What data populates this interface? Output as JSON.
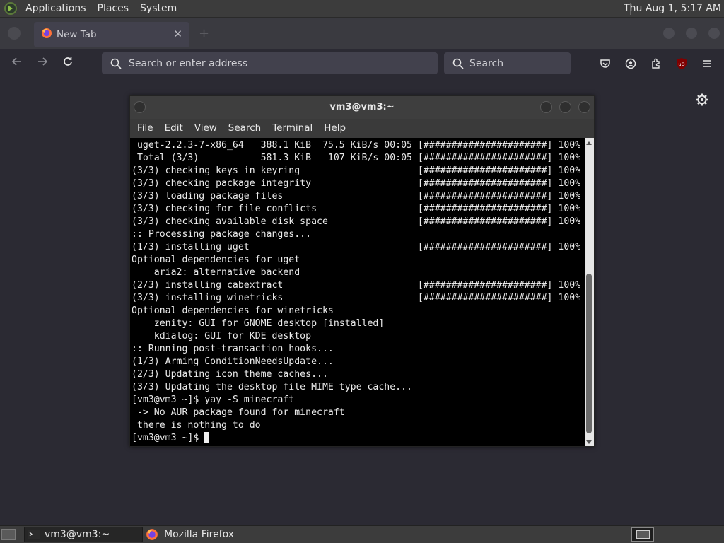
{
  "top_panel": {
    "menus": [
      "Applications",
      "Places",
      "System"
    ],
    "clock": "Thu Aug  1, 5:17 AM"
  },
  "browser": {
    "tab": {
      "title": "New Tab"
    },
    "address_placeholder": "Search or enter address",
    "search_placeholder": "Search",
    "ublock_badge": "uO"
  },
  "terminal": {
    "title": "vm3@vm3:~",
    "menus": [
      "File",
      "Edit",
      "View",
      "Search",
      "Terminal",
      "Help"
    ],
    "lines": [
      " uget-2.2.3-7-x86_64   388.1 KiB  75.5 KiB/s 00:05 [######################] 100%",
      " Total (3/3)           581.3 KiB   107 KiB/s 00:05 [######################] 100%",
      "(3/3) checking keys in keyring                     [######################] 100%",
      "(3/3) checking package integrity                   [######################] 100%",
      "(3/3) loading package files                        [######################] 100%",
      "(3/3) checking for file conflicts                  [######################] 100%",
      "(3/3) checking available disk space                [######################] 100%",
      ":: Processing package changes...",
      "(1/3) installing uget                              [######################] 100%",
      "Optional dependencies for uget",
      "    aria2: alternative backend",
      "(2/3) installing cabextract                        [######################] 100%",
      "(3/3) installing winetricks                        [######################] 100%",
      "Optional dependencies for winetricks",
      "    zenity: GUI for GNOME desktop [installed]",
      "    kdialog: GUI for KDE desktop",
      ":: Running post-transaction hooks...",
      "(1/3) Arming ConditionNeedsUpdate...",
      "(2/3) Updating icon theme caches...",
      "(3/3) Updating the desktop file MIME type cache...",
      "[vm3@vm3 ~]$ yay -S minecraft",
      " -> No AUR package found for minecraft",
      " there is nothing to do"
    ],
    "prompt": "[vm3@vm3 ~]$ "
  },
  "taskbar": {
    "tasks": [
      {
        "label": "vm3@vm3:~",
        "icon": "terminal-icon"
      },
      {
        "label": "Mozilla Firefox",
        "icon": "firefox-icon"
      }
    ]
  },
  "colors": {
    "panel": "#3c3c3c",
    "browser_bg": "#2b2a33",
    "terminal_bg": "#000000",
    "terminal_fg": "#e9e9e9"
  }
}
